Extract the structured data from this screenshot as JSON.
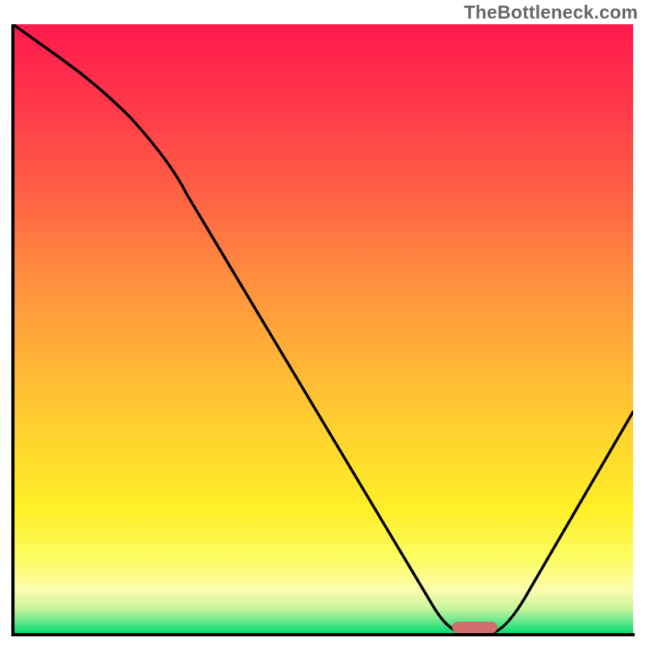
{
  "watermark": "TheBottleneck.com",
  "colors": {
    "gradient_top": "#ff1a4d",
    "gradient_mid1": "#ff8f3e",
    "gradient_mid2": "#fff028",
    "gradient_bottom": "#06db6e",
    "curve": "#000000",
    "axis": "#000000",
    "marker": "#d36e6e",
    "watermark": "#666666"
  },
  "chart_data": {
    "type": "line",
    "title": "",
    "xlabel": "",
    "ylabel": "",
    "xlim": [
      0,
      100
    ],
    "ylim": [
      0,
      100
    ],
    "x": [
      0,
      5,
      10,
      15,
      20,
      25,
      30,
      35,
      40,
      45,
      50,
      55,
      60,
      65,
      70,
      72,
      75,
      80,
      85,
      90,
      95,
      100
    ],
    "values": [
      100,
      96,
      90,
      84,
      78,
      73,
      67,
      58,
      50,
      41,
      33,
      25,
      17,
      9,
      2,
      0,
      0,
      3,
      11,
      20,
      28,
      36
    ],
    "series": [
      {
        "name": "bottleneck-curve",
        "x": [
          0,
          5,
          10,
          15,
          20,
          25,
          30,
          35,
          40,
          45,
          50,
          55,
          60,
          65,
          70,
          72,
          75,
          80,
          85,
          90,
          95,
          100
        ],
        "y": [
          100,
          96,
          90,
          84,
          78,
          73,
          67,
          58,
          50,
          41,
          33,
          25,
          17,
          9,
          2,
          0,
          0,
          3,
          11,
          20,
          28,
          36
        ]
      }
    ],
    "marker": {
      "x_start": 70,
      "x_end": 78,
      "y": 0
    },
    "legend": false,
    "grid": false
  }
}
